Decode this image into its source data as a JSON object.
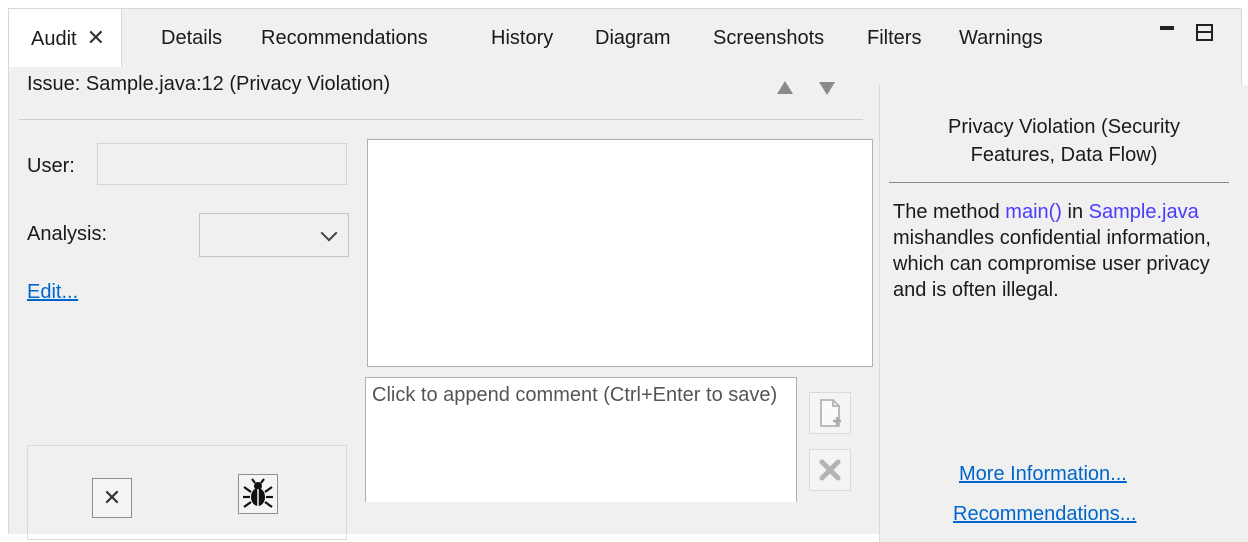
{
  "tabs": [
    {
      "label": "Audit",
      "active": true,
      "closable": true
    },
    {
      "label": "Details"
    },
    {
      "label": "Recommendations"
    },
    {
      "label": "History"
    },
    {
      "label": "Diagram"
    },
    {
      "label": "Screenshots"
    },
    {
      "label": "Filters"
    },
    {
      "label": "Warnings"
    }
  ],
  "window_controls": {
    "minimize_icon": "minimize-icon",
    "maximize_icon": "maximize-icon"
  },
  "issue": {
    "title": "Issue: Sample.java:12 (Privacy Violation)",
    "prev_icon": "triangle-up-icon",
    "next_icon": "triangle-down-icon"
  },
  "form": {
    "user_label": "User:",
    "user_value": "",
    "analysis_label": "Analysis:",
    "analysis_value": "",
    "edit_link": "Edit..."
  },
  "comment": {
    "main_text": "",
    "placeholder": "Click to append comment (Ctrl+Enter to save)",
    "add_icon": "add-comment-icon",
    "delete_icon": "delete-comment-icon"
  },
  "actions": {
    "close_icon": "close-icon",
    "bug_icon": "bug-icon"
  },
  "description": {
    "title": "Privacy Violation (Security Features, Data Flow)",
    "body_prefix": "The method ",
    "method_link": "main()",
    "body_in": " in ",
    "file_link": "Sample.java",
    "body_suffix": " mishandles confidential information, which can compromise user privacy and is often illegal.",
    "more_info_link": "More Information...",
    "recommendations_link": "Recommendations..."
  },
  "colors": {
    "link": "#0066cc",
    "code_link": "#4a3cff",
    "panel_bg": "#f0f0f0"
  }
}
